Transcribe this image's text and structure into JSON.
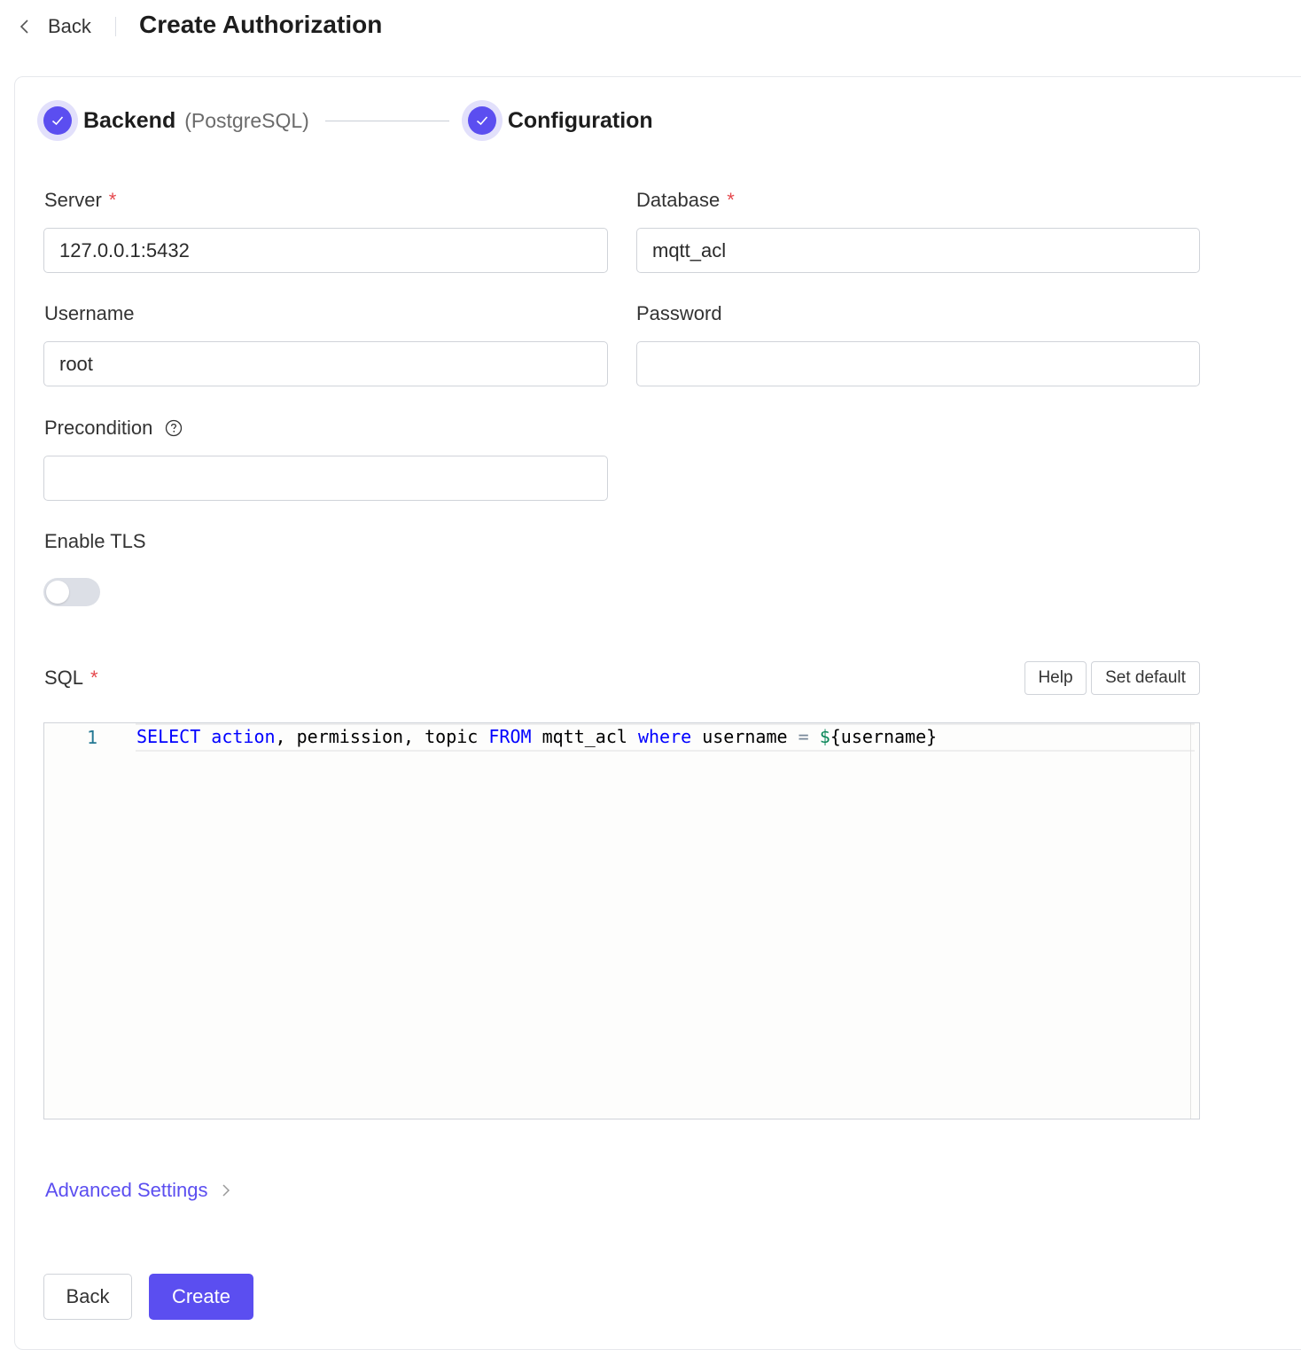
{
  "header": {
    "back_label": "Back",
    "title": "Create Authorization"
  },
  "steps": [
    {
      "title": "Backend",
      "subtitle": "(PostgreSQL)",
      "status": "done"
    },
    {
      "title": "Configuration",
      "subtitle": "",
      "status": "done"
    }
  ],
  "form": {
    "server": {
      "label": "Server",
      "required": "*",
      "value": "127.0.0.1:5432"
    },
    "database": {
      "label": "Database",
      "required": "*",
      "value": "mqtt_acl"
    },
    "username": {
      "label": "Username",
      "value": "root"
    },
    "password": {
      "label": "Password",
      "value": ""
    },
    "precondition": {
      "label": "Precondition",
      "value": ""
    },
    "enable_tls": {
      "label": "Enable TLS",
      "value": false
    },
    "sql": {
      "label": "SQL",
      "required": "*",
      "help_label": "Help",
      "set_default_label": "Set default",
      "line_number": "1",
      "tokens": {
        "select": "SELECT",
        "action": "action",
        "part1": ", permission, topic ",
        "from": "FROM",
        "part2": " mqtt_acl ",
        "where": "where",
        "part3": " username ",
        "eq": "=",
        "dollar": "$",
        "part4": "{username}"
      }
    }
  },
  "advanced": {
    "label": "Advanced Settings"
  },
  "footer": {
    "back_label": "Back",
    "create_label": "Create"
  },
  "colors": {
    "accent": "#5b4ef0",
    "required": "#e5484d",
    "sql_keyword": "#0000ff",
    "sql_variable": "#098658"
  }
}
